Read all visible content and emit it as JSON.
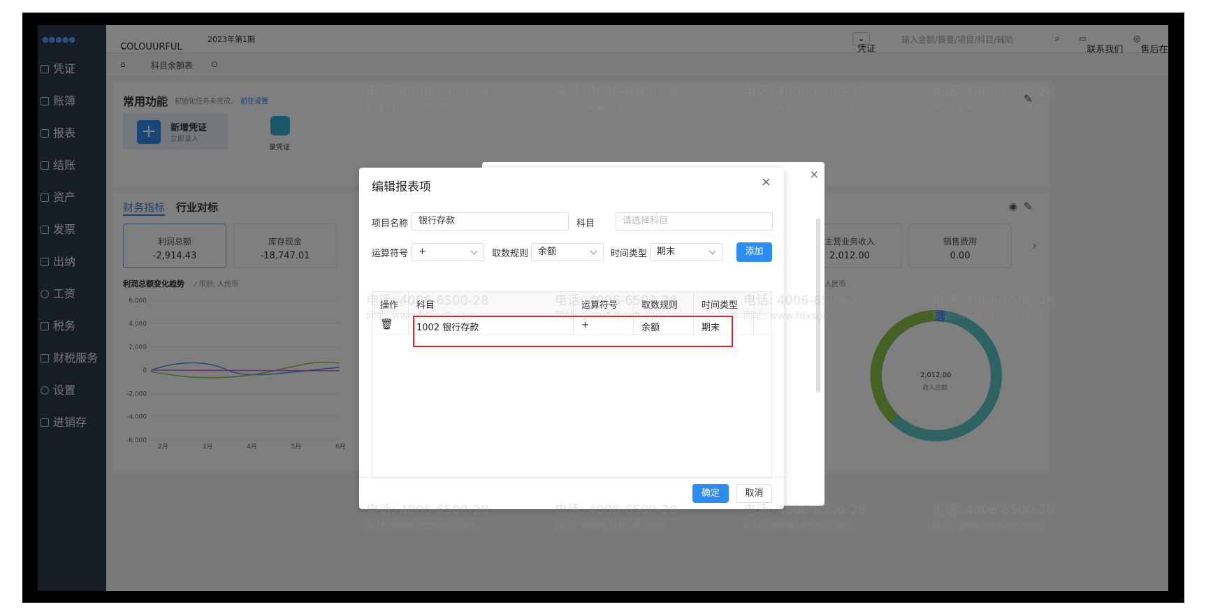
{
  "app": {
    "company": "COLOUURFUL",
    "period": "2023年第1期",
    "search_type": "凭证",
    "search_placeholder": "输入金额/摘要/项目/科目/辅助",
    "contact": "联系我们",
    "service": "售后在线服务"
  },
  "sidebar": {
    "items": [
      {
        "label": "凭证"
      },
      {
        "label": "账簿"
      },
      {
        "label": "报表"
      },
      {
        "label": "结账"
      },
      {
        "label": "资产"
      },
      {
        "label": "发票"
      },
      {
        "label": "出纳"
      },
      {
        "label": "工资"
      },
      {
        "label": "税务"
      },
      {
        "label": "财税服务"
      },
      {
        "label": "设置"
      },
      {
        "label": "进销存"
      }
    ]
  },
  "tabs": {
    "current": "科目余额表"
  },
  "common": {
    "title": "常用功能",
    "tip": "初始化任务未完成,",
    "tip_link": "前往设置",
    "new_voucher": "新增凭证",
    "new_voucher_sub": "立即录入",
    "record_voucher": "录凭证"
  },
  "finance": {
    "tab1": "财务指标",
    "tab2": "行业对标",
    "metrics": [
      {
        "label": "利润总额",
        "value": "-2,914.43"
      },
      {
        "label": "库存现金",
        "value": "-18,747.01"
      },
      {
        "label": "主营业务收入",
        "value": "2,012.00"
      },
      {
        "label": "销售费用",
        "value": "0.00"
      }
    ],
    "trend_title": "利润总额变化趋势",
    "trend_unit": "/ 币别: 人民币",
    "right_unit": "/ 币别: 人民币",
    "donut_value": "2,012.00",
    "donut_label": "收入总额"
  },
  "chart_data": {
    "type": "line",
    "title": "利润总额变化趋势",
    "categories": [
      "2月",
      "3月",
      "4月",
      "5月",
      "6月"
    ],
    "yticks": [
      "6,000",
      "4,000",
      "2,000",
      "0",
      "-2,000",
      "-4,000",
      "-6,000"
    ],
    "ylim": [
      -6000,
      6000
    ]
  },
  "dialog": {
    "title": "编辑报表项",
    "name_label": "项目名称",
    "name_value": "银行存款",
    "subject_label": "科目",
    "subject_placeholder": "请选择科目",
    "operator_label": "运算符号",
    "operator_value": "+",
    "rule_label": "取数规则",
    "rule_value": "余额",
    "time_label": "时间类型",
    "time_value": "期末",
    "add_button": "添加",
    "columns": [
      "操作",
      "科目",
      "运算符号",
      "取数规则",
      "时间类型"
    ],
    "rows": [
      {
        "subject": "1002 银行存款",
        "operator": "+",
        "rule": "余额",
        "time": "期末"
      }
    ],
    "ok": "确定",
    "cancel": "取消"
  },
  "watermark": {
    "phone": "电话: 4006-6500-28",
    "site": "网址: www.tdxsoft.com"
  }
}
